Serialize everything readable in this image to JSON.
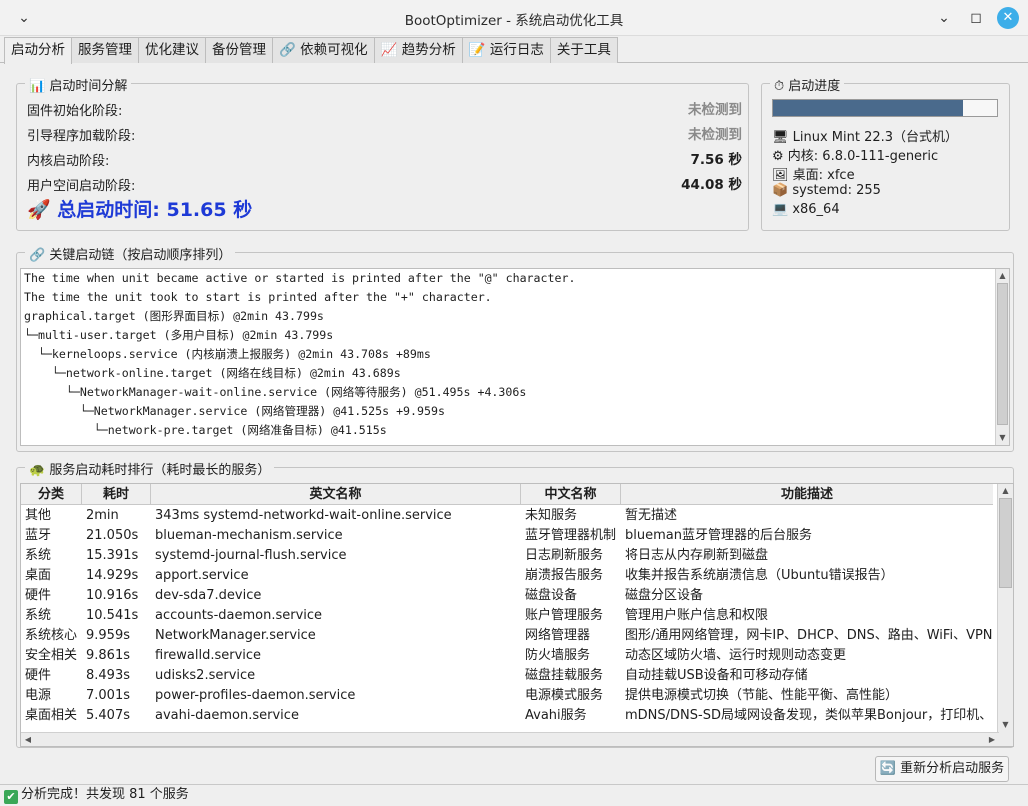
{
  "window": {
    "title": "BootOptimizer - 系统启动优化工具",
    "menu_glyph": "⌄",
    "minimize_glyph": "⌄",
    "maximize_glyph": "◻",
    "close_glyph": "✕"
  },
  "tabs": [
    {
      "label": "启动分析"
    },
    {
      "label": "服务管理"
    },
    {
      "label": "优化建议"
    },
    {
      "label": "备份管理"
    },
    {
      "label": "🔗 依赖可视化"
    },
    {
      "label": "📈 趋势分析"
    },
    {
      "label": "📝 运行日志"
    },
    {
      "label": "关于工具"
    }
  ],
  "breakdown": {
    "title": "📊 启动时间分解",
    "rows": [
      {
        "label": "固件初始化阶段:",
        "value": "未检测到"
      },
      {
        "label": "引导程序加载阶段:",
        "value": "未检测到"
      },
      {
        "label": "内核启动阶段:",
        "value": "7.56 秒"
      },
      {
        "label": "用户空间启动阶段:",
        "value": "44.08 秒"
      }
    ],
    "total": "🚀 总启动时间: 51.65 秒"
  },
  "progress": {
    "title": "⏱ 启动进度",
    "fraction": 0.85,
    "info": [
      "🖥 Linux Mint 22.3（台式机）",
      "⚙ 内核: 6.8.0-111-generic",
      "🖼 桌面: xfce",
      "📦 systemd: 255",
      "💻 x86_64"
    ]
  },
  "chain": {
    "title": "🔗 关键启动链（按启动顺序排列）",
    "lines": [
      "The time when unit became active or started is printed after the \"@\" character.",
      "The time the unit took to start is printed after the \"+\" character.",
      "graphical.target (图形界面目标) @2min 43.799s",
      "└─multi-user.target (多用户目标) @2min 43.799s",
      "  └─kerneloops.service (内核崩溃上报服务) @2min 43.708s +89ms",
      "    └─network-online.target (网络在线目标) @2min 43.689s",
      "      └─NetworkManager-wait-online.service (网络等待服务) @51.495s +4.306s",
      "        └─NetworkManager.service (网络管理器) @41.525s +9.959s",
      "          └─network-pre.target (网络准备目标) @41.515s"
    ]
  },
  "services": {
    "title": "🐢 服务启动耗时排行（耗时最长的服务）",
    "columns": [
      "分类",
      "耗时",
      "英文名称",
      "中文名称",
      "功能描述"
    ],
    "rows": [
      [
        "其他",
        "2min",
        "343ms systemd-networkd-wait-online.service",
        "未知服务",
        "暂无描述"
      ],
      [
        "蓝牙",
        "21.050s",
        "blueman-mechanism.service",
        "蓝牙管理器机制",
        "blueman蓝牙管理器的后台服务"
      ],
      [
        "系统",
        "15.391s",
        "systemd-journal-flush.service",
        "日志刷新服务",
        "将日志从内存刷新到磁盘"
      ],
      [
        "桌面",
        "14.929s",
        "apport.service",
        "崩溃报告服务",
        "收集并报告系统崩溃信息（Ubuntu错误报告）"
      ],
      [
        "硬件",
        "10.916s",
        "dev-sda7.device",
        "磁盘设备",
        "磁盘分区设备"
      ],
      [
        "系统",
        "10.541s",
        "accounts-daemon.service",
        "账户管理服务",
        "管理用户账户信息和权限"
      ],
      [
        "系统核心",
        "9.959s",
        "NetworkManager.service",
        "网络管理器",
        "图形/通用网络管理，网卡IP、DHCP、DNS、路由、WiFi、VPN统"
      ],
      [
        "安全相关",
        "9.861s",
        "firewalld.service",
        "防火墙服务",
        "动态区域防火墙、运行时规则动态变更"
      ],
      [
        "硬件",
        "8.493s",
        "udisks2.service",
        "磁盘挂载服务",
        "自动挂载USB设备和可移动存储"
      ],
      [
        "电源",
        "7.001s",
        "power-profiles-daemon.service",
        "电源模式服务",
        "提供电源模式切换（节能、性能平衡、高性能）"
      ],
      [
        "桌面相关",
        "5.407s",
        "avahi-daemon.service",
        "Avahi服务",
        "mDNS/DNS-SD局域网设备发现，类似苹果Bonjour，打印机、i"
      ]
    ]
  },
  "reanalyze_button": "🔄 重新分析启动服务",
  "status": {
    "icon": "✔",
    "text": "分析完成！共发现 81 个服务"
  }
}
